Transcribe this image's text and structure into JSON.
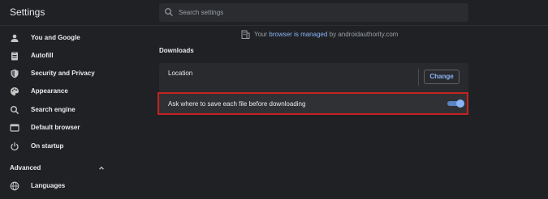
{
  "header": {
    "title": "Settings",
    "search_placeholder": "Search settings"
  },
  "sidebar": {
    "items": [
      {
        "label": "You and Google",
        "icon": "person-icon"
      },
      {
        "label": "Autofill",
        "icon": "clipboard-icon"
      },
      {
        "label": "Security and Privacy",
        "icon": "shield-icon"
      },
      {
        "label": "Appearance",
        "icon": "palette-icon"
      },
      {
        "label": "Search engine",
        "icon": "search-icon"
      },
      {
        "label": "Default browser",
        "icon": "browser-icon"
      },
      {
        "label": "On startup",
        "icon": "power-icon"
      }
    ],
    "advanced": {
      "label": "Advanced",
      "expanded": true
    },
    "advanced_items": [
      {
        "label": "Languages",
        "icon": "globe-icon"
      }
    ]
  },
  "managed_notice": {
    "prefix": "Your ",
    "link_text": "browser is managed",
    "suffix": " by androidauthority.com"
  },
  "downloads": {
    "section_title": "Downloads",
    "location_label": "Location",
    "change_button": "Change",
    "ask_label": "Ask where to save each file before downloading",
    "ask_enabled": true
  },
  "colors": {
    "background": "#202124",
    "card": "#292a2d",
    "accent": "#8ab4f8",
    "highlight_border": "#c5221f"
  }
}
